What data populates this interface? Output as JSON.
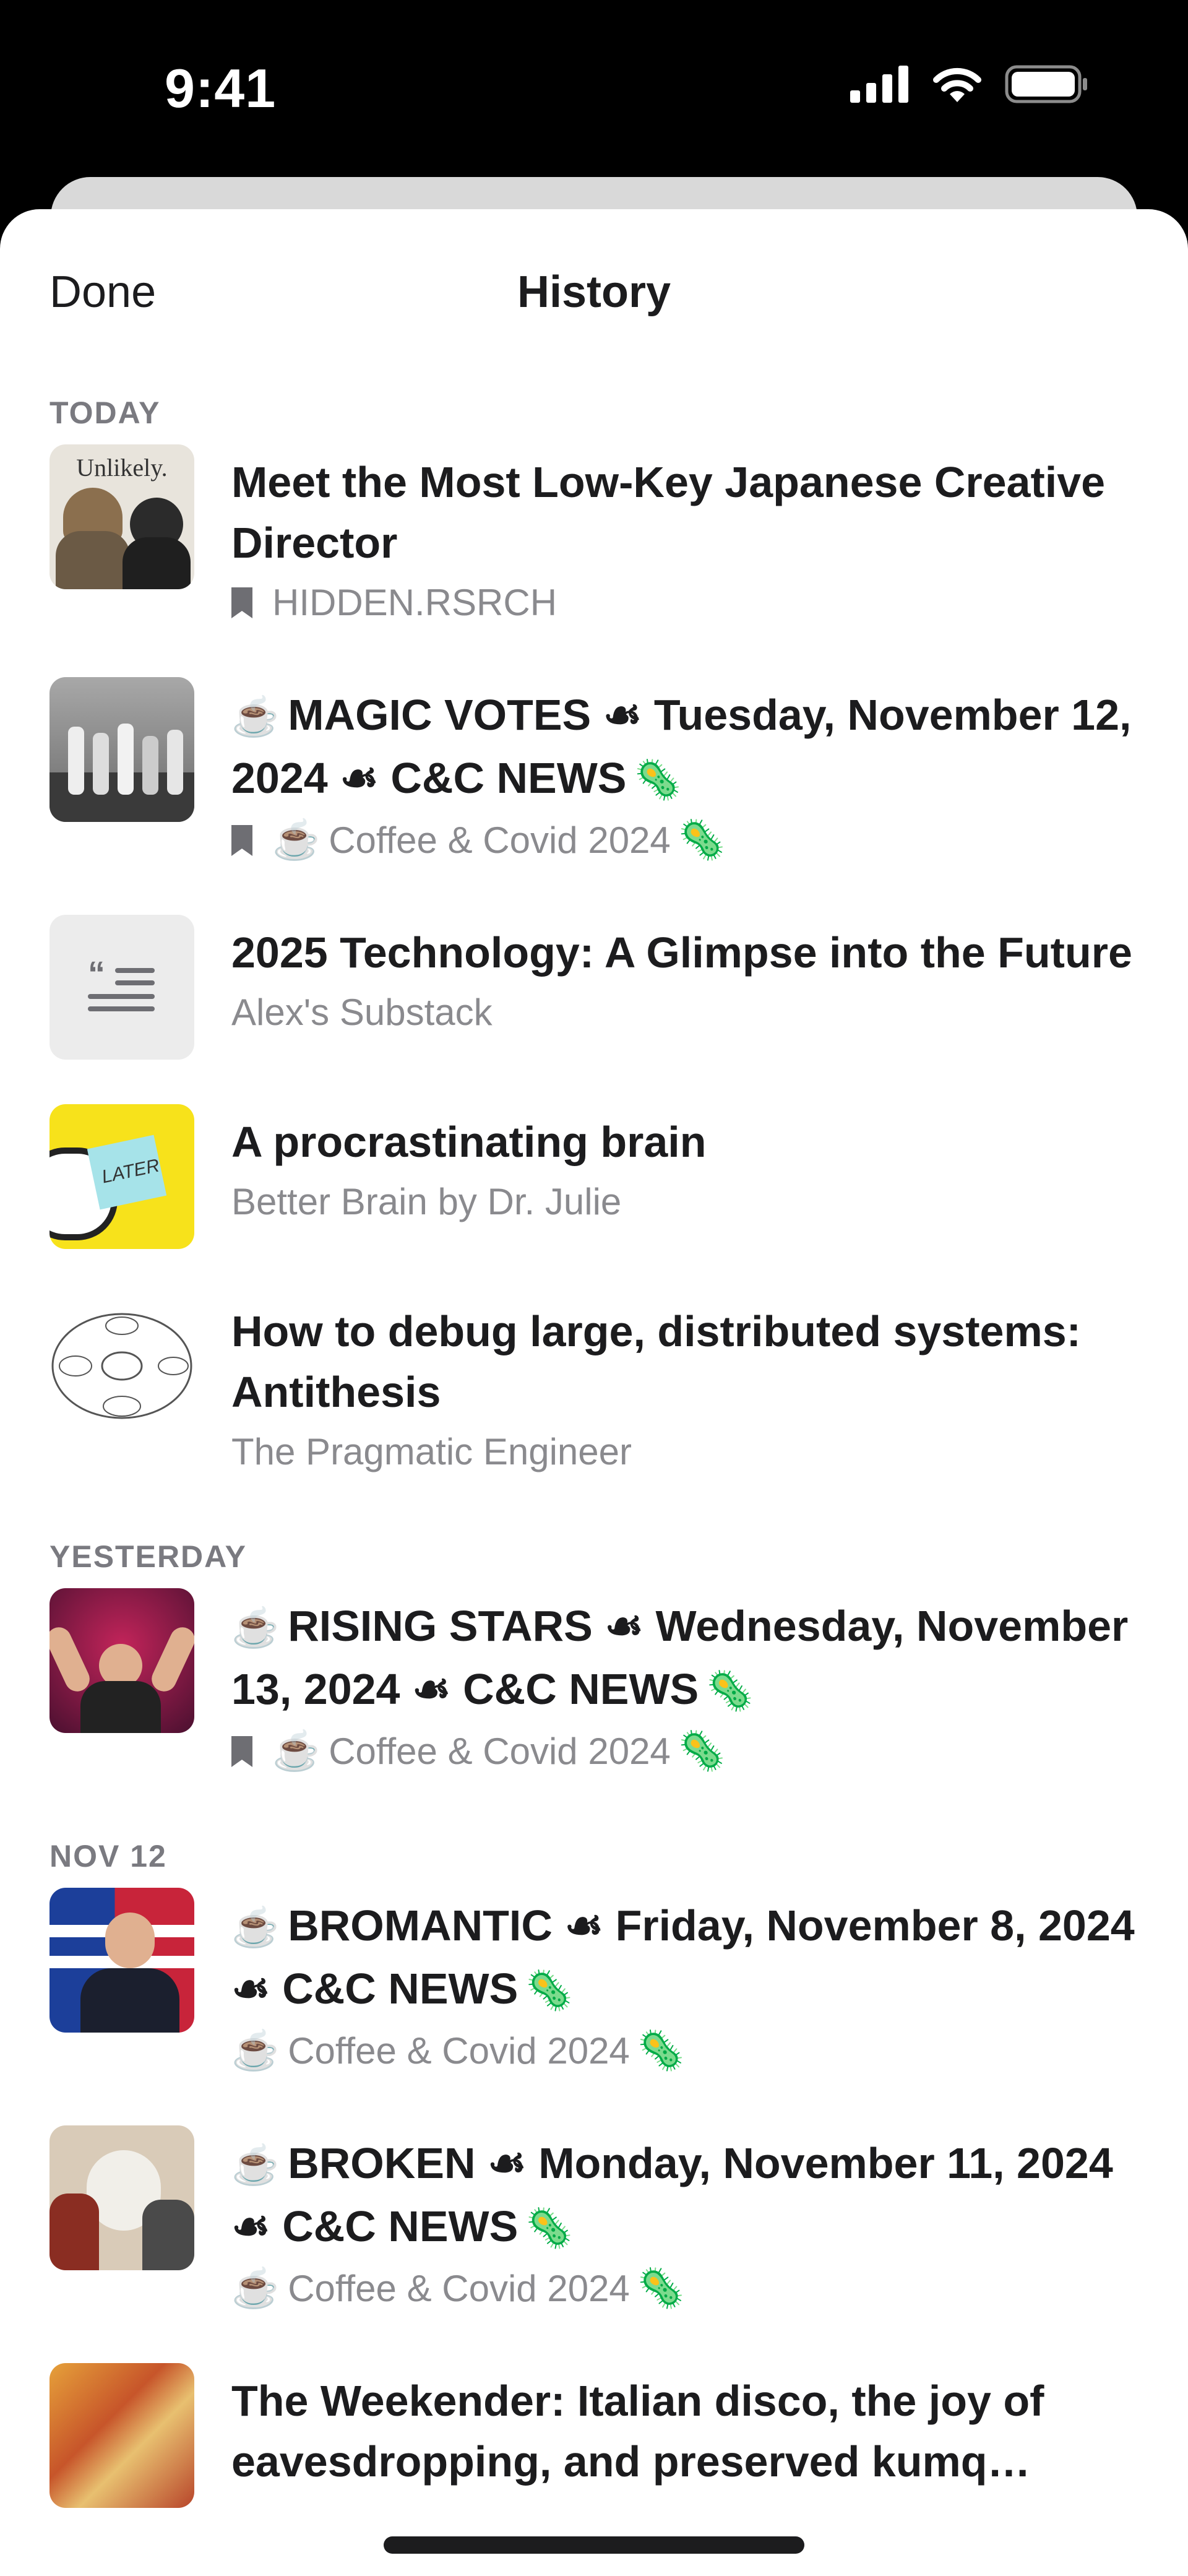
{
  "status_bar": {
    "time": "9:41",
    "icons": [
      "cellular-signal-icon",
      "wifi-icon",
      "battery-icon"
    ]
  },
  "nav": {
    "done_label": "Done",
    "title": "History"
  },
  "sections": {
    "today": "TODAY",
    "yesterday": "YESTERDAY",
    "nov12": "NOV 12"
  },
  "items": [
    {
      "title": "Meet the Most Low-Key Japanese Creative Director",
      "source": "HIDDEN.RSRCH",
      "thumb_text": "Unlikely."
    },
    {
      "title": "MAGIC VOTES ☙ Tuesday, November 12, 2024 ☙ C&C NEWS",
      "source": "Coffee & Covid 2024"
    },
    {
      "title": "2025 Technology: A Glimpse into the Future",
      "source": "Alex's Substack"
    },
    {
      "title": "A procrastinating brain",
      "source": "Better Brain by Dr. Julie",
      "thumb_text": "LATER"
    },
    {
      "title": "How to debug large, distributed systems: Antithesis",
      "source": "The Pragmatic Engineer"
    },
    {
      "title": "RISING STARS ☙ Wednesday, November 13, 2024 ☙ C&C NEWS",
      "source": "Coffee & Covid 2024"
    },
    {
      "title": "BROMANTIC ☙ Friday, November 8, 2024 ☙ C&C NEWS",
      "source": "Coffee & Covid 2024"
    },
    {
      "title": "BROKEN ☙ Monday, November 11, 2024 ☙ C&C NEWS",
      "source": "Coffee & Covid 2024"
    },
    {
      "title": "The Weekender: Italian disco, the joy of eavesdropping, and preserved kumq…",
      "source": ""
    }
  ],
  "emoji": {
    "coffee": "☕",
    "virus": "🦠"
  },
  "colors": {
    "accent_text": "#1c1c1e",
    "secondary_text": "#8a8a8e",
    "section_header": "#7a7a80",
    "sheet_bg": "#ffffff"
  }
}
